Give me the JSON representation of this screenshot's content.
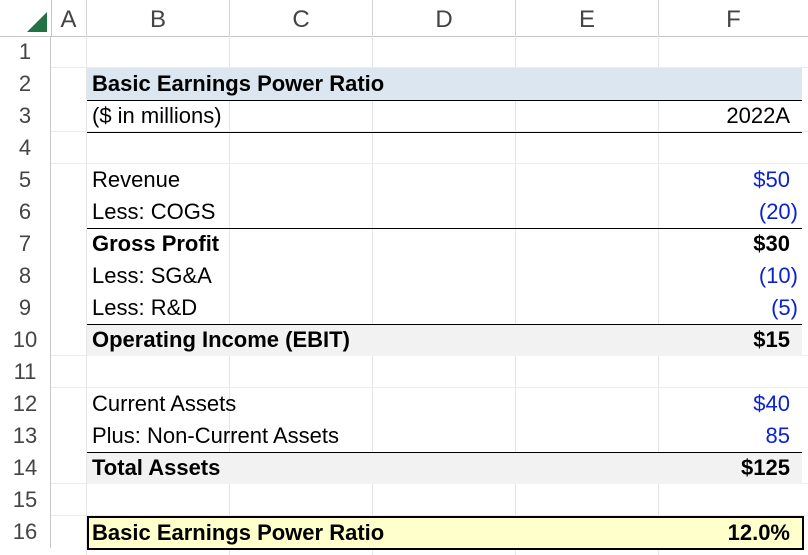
{
  "columns": [
    "A",
    "B",
    "C",
    "D",
    "E",
    "F"
  ],
  "rows": [
    "1",
    "2",
    "3",
    "4",
    "5",
    "6",
    "7",
    "8",
    "9",
    "10",
    "11",
    "12",
    "13",
    "14",
    "15",
    "16"
  ],
  "table": {
    "title": "Basic Earnings Power Ratio",
    "units_label": "($ in millions)",
    "period": "2022A",
    "lines": [
      {
        "label": "Revenue",
        "value": "$50"
      },
      {
        "label": "Less: COGS",
        "value": "(20)"
      },
      {
        "label": "Gross Profit",
        "value": "$30"
      },
      {
        "label": "Less: SG&A",
        "value": "(10)"
      },
      {
        "label": "Less: R&D",
        "value": "(5)"
      },
      {
        "label": "Operating Income (EBIT)",
        "value": "$15"
      },
      {
        "label": "Current Assets",
        "value": "$40"
      },
      {
        "label": "Plus: Non-Current Assets",
        "value": "85"
      },
      {
        "label": "Total Assets",
        "value": "$125"
      }
    ],
    "result": {
      "label": "Basic Earnings Power Ratio",
      "value": "12.0%"
    }
  },
  "colors": {
    "input_blue": "#0b22d2",
    "title_fill": "#dce6f1",
    "result_fill": "#ffffcc",
    "total_fill": "#f2f2f2",
    "excel_green": "#217346"
  }
}
